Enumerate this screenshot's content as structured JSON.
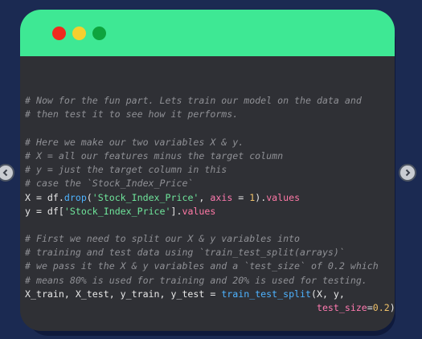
{
  "window": {
    "buttons": [
      "close",
      "minimize",
      "maximize"
    ]
  },
  "code": {
    "lines": [
      [],
      [
        {
          "t": "# Now for the fun part. Lets train our model on the data and",
          "c": "comment"
        }
      ],
      [
        {
          "t": "# then test it to see how it performs.",
          "c": "comment"
        }
      ],
      [],
      [
        {
          "t": "# Here we make our two variables X & y.",
          "c": "comment"
        }
      ],
      [
        {
          "t": "# X = all our features minus the target column",
          "c": "comment"
        }
      ],
      [
        {
          "t": "# y = just the target column in this",
          "c": "comment"
        }
      ],
      [
        {
          "t": "# case the `Stock_Index_Price`",
          "c": "comment"
        }
      ],
      [
        {
          "t": "X ",
          "c": "var"
        },
        {
          "t": "=",
          "c": "op"
        },
        {
          "t": " df.",
          "c": "var"
        },
        {
          "t": "drop",
          "c": "fn"
        },
        {
          "t": "(",
          "c": "var"
        },
        {
          "t": "'Stock_Index_Price'",
          "c": "str"
        },
        {
          "t": ", ",
          "c": "var"
        },
        {
          "t": "axis",
          "c": "kw"
        },
        {
          "t": " = ",
          "c": "op"
        },
        {
          "t": "1",
          "c": "num"
        },
        {
          "t": ").",
          "c": "var"
        },
        {
          "t": "values",
          "c": "attr"
        }
      ],
      [
        {
          "t": "y ",
          "c": "var"
        },
        {
          "t": "=",
          "c": "op"
        },
        {
          "t": " df[",
          "c": "var"
        },
        {
          "t": "'Stock_Index_Price'",
          "c": "str"
        },
        {
          "t": "].",
          "c": "var"
        },
        {
          "t": "values",
          "c": "attr"
        }
      ],
      [],
      [
        {
          "t": "# First we need to split our X & y variables into",
          "c": "comment"
        }
      ],
      [
        {
          "t": "# training and test data using `train_test_split(arrays)`",
          "c": "comment"
        }
      ],
      [
        {
          "t": "# we pass it the X & y variables and a `test_size` of 0.2 which",
          "c": "comment"
        }
      ],
      [
        {
          "t": "# means 80% is used for training and 20% is used for testing.",
          "c": "comment"
        }
      ],
      [
        {
          "t": "X_train, X_test, y_train, y_test ",
          "c": "var"
        },
        {
          "t": "=",
          "c": "op"
        },
        {
          "t": " ",
          "c": "var"
        },
        {
          "t": "train_test_split",
          "c": "fn"
        },
        {
          "t": "(X, y,",
          "c": "var"
        }
      ],
      [
        {
          "t": "                                                    ",
          "c": "var"
        },
        {
          "t": "test_size",
          "c": "kw"
        },
        {
          "t": "=",
          "c": "op"
        },
        {
          "t": "0.2",
          "c": "num"
        },
        {
          "t": ")",
          "c": "var"
        }
      ]
    ]
  },
  "navigation": {
    "prev_icon": "chevron-left-icon",
    "next_icon": "chevron-right-icon"
  },
  "colors": {
    "page_bg": "#1b2a52",
    "titlebar": "#3ee894",
    "editor_bg": "#2f3035",
    "comment": "#8f9095",
    "string": "#6fe59b",
    "function": "#4eb3ff",
    "keyword": "#ff7ab0",
    "number": "#f0c26a"
  }
}
